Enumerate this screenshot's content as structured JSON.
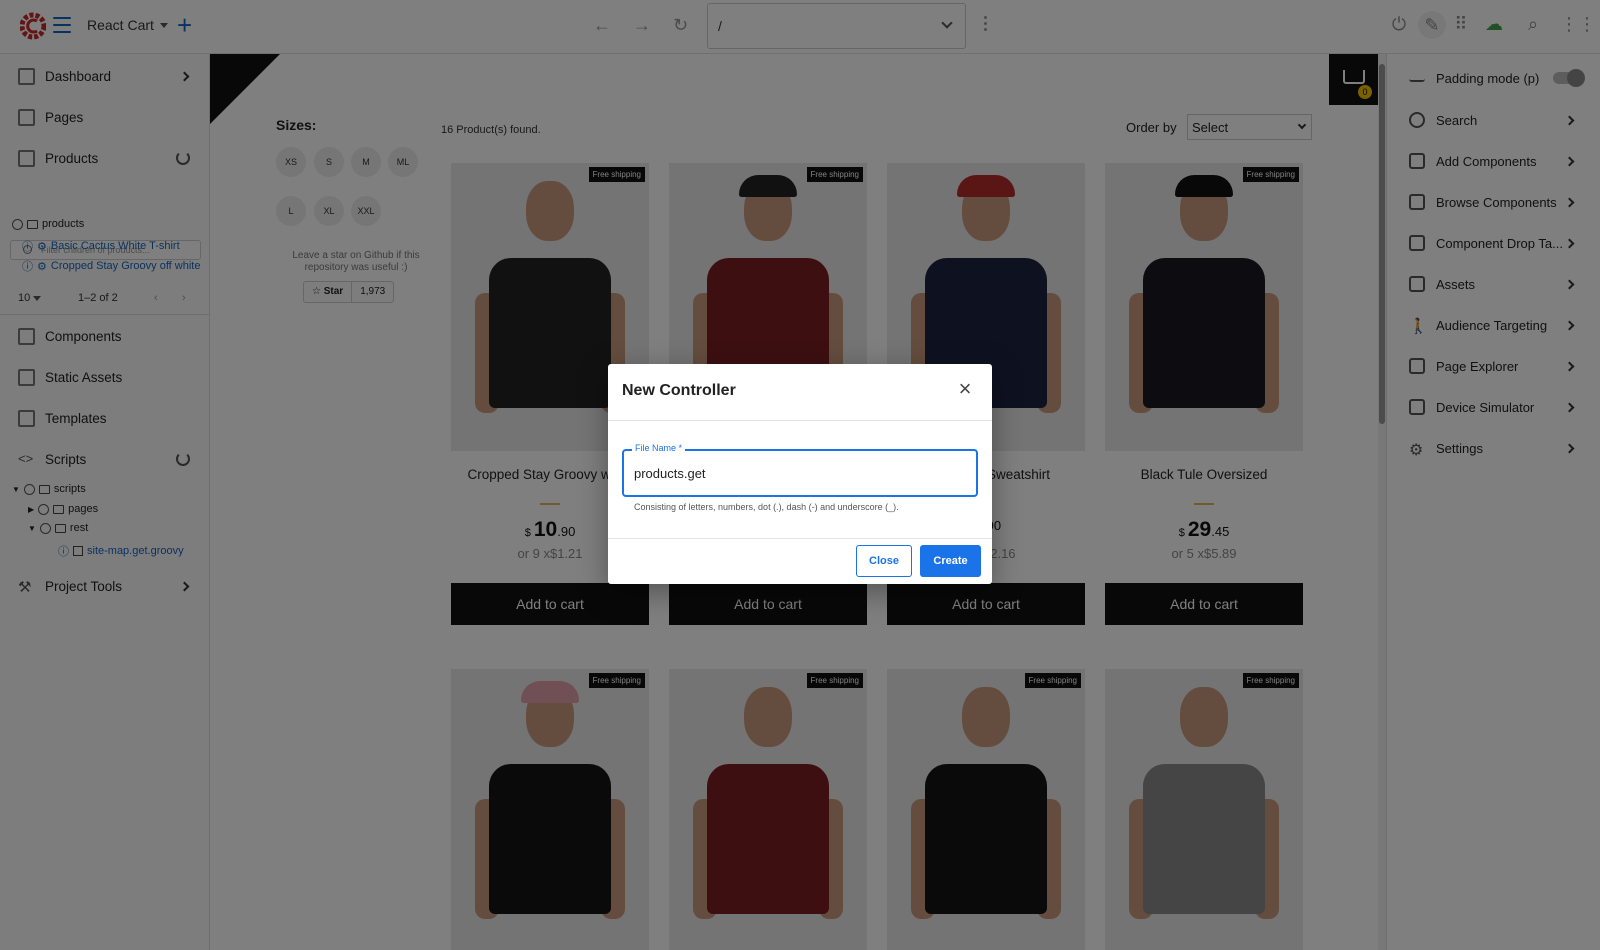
{
  "topbar": {
    "project_name": "React Cart",
    "url": "/"
  },
  "sidebar": {
    "items": [
      {
        "label": "Dashboard",
        "icon": "dashboard-icon"
      },
      {
        "label": "Pages",
        "icon": "page-icon"
      },
      {
        "label": "Products",
        "icon": "products-icon"
      },
      {
        "label": "Components",
        "icon": "puzzle-icon"
      },
      {
        "label": "Static Assets",
        "icon": "image-icon"
      },
      {
        "label": "Templates",
        "icon": "template-icon"
      },
      {
        "label": "Scripts",
        "icon": "code-icon"
      },
      {
        "label": "Project Tools",
        "icon": "tools-icon"
      }
    ],
    "filter_placeholder": "Filter children of products...",
    "products_tree": {
      "root": "products",
      "children": [
        "Basic Cactus White T-shirt",
        "Cropped Stay Groovy off white"
      ]
    },
    "pager": {
      "per_page": "10",
      "range": "1–2 of 2"
    },
    "scripts_tree": {
      "root": "scripts",
      "children": [
        "pages",
        "rest"
      ],
      "file": "site-map.get.groovy"
    }
  },
  "shop": {
    "sizes_title": "Sizes:",
    "sizes": [
      "XS",
      "S",
      "M",
      "ML",
      "L",
      "XL",
      "XXL"
    ],
    "github_hint": "Leave a star on Github if this repository was useful :)",
    "star_label": "Star",
    "star_count": "1,973",
    "found_text": "16 Product(s) found.",
    "order_by_label": "Order by",
    "order_select_value": "Select",
    "cart_count": "0",
    "free_shipping": "Free shipping",
    "add_to_cart": "Add to cart",
    "products": [
      {
        "name": "Cropped Stay Groovy white",
        "currency": "$",
        "price_int": "10",
        "price_dec": ".90",
        "installments": "or 9 x$1.21"
      },
      {
        "name": "",
        "currency": "",
        "price_int": "",
        "price_dec": "",
        "installments": ""
      },
      {
        "name": "Sweatshirt",
        "currency": "",
        "price_int": "",
        "price_dec": ".90",
        "installments": "$2.16"
      },
      {
        "name": "Black Tule Oversized",
        "currency": "$",
        "price_int": "29",
        "price_dec": ".45",
        "installments": "or 5 x$5.89"
      }
    ]
  },
  "right_panel": {
    "items": [
      {
        "label": "Padding mode (p)"
      },
      {
        "label": "Search"
      },
      {
        "label": "Add Components"
      },
      {
        "label": "Browse Components"
      },
      {
        "label": "Component Drop Ta..."
      },
      {
        "label": "Assets"
      },
      {
        "label": "Audience Targeting"
      },
      {
        "label": "Page Explorer"
      },
      {
        "label": "Device Simulator"
      },
      {
        "label": "Settings"
      }
    ]
  },
  "dialog": {
    "title": "New Controller",
    "field_label": "File Name *",
    "field_value": "products.get",
    "field_hint": "Consisting of letters, numbers, dot (.), dash (-) and underscore (_).",
    "close_label": "Close",
    "create_label": "Create"
  },
  "colors": {
    "accent": "#1a73e8",
    "brand_red": "#d32f2f",
    "cart_badge": "#f5c000"
  }
}
